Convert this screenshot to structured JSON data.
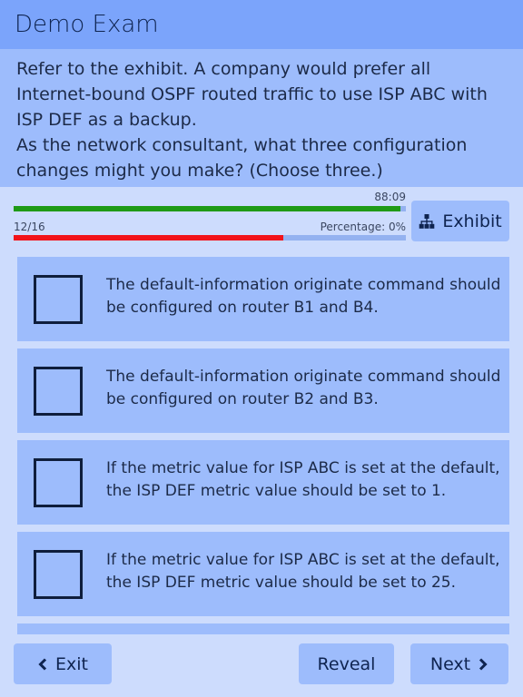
{
  "header": {
    "title": "Demo Exam"
  },
  "question": {
    "lines": [
      "Refer to the exhibit. A company would prefer all Internet-bound OSPF routed traffic to use ISP ABC with ISP DEF as a backup.",
      "As the network consultant, what three configuration changes might you make? (Choose three.)"
    ]
  },
  "progress": {
    "time_remaining": "88:09",
    "time_fraction": 0.985,
    "question_count": "12/16",
    "percentage_label": "Percentage: 0%",
    "answered_fraction": 0.6875
  },
  "exhibit_button": {
    "label": "Exhibit",
    "icon": "sitemap-icon"
  },
  "options": [
    {
      "text": "The default-information originate command should be configured on router B1 and B4.",
      "checked": false
    },
    {
      "text": "The default-information originate command should be configured on router B2 and B3.",
      "checked": false
    },
    {
      "text": "If the metric value for ISP ABC is set at the default, the ISP DEF metric value should be set to 1.",
      "checked": false
    },
    {
      "text": "If the metric value for ISP ABC is set at the default, the ISP DEF metric value should be set to 25.",
      "checked": false
    }
  ],
  "footer": {
    "exit_label": "Exit",
    "reveal_label": "Reveal",
    "next_label": "Next"
  },
  "colors": {
    "header_bg": "#7ba4fb",
    "panel_bg": "#9dbcfc",
    "page_bg": "#cddcfd",
    "time_bar": "#1f9a16",
    "score_bar": "#f2131a"
  }
}
